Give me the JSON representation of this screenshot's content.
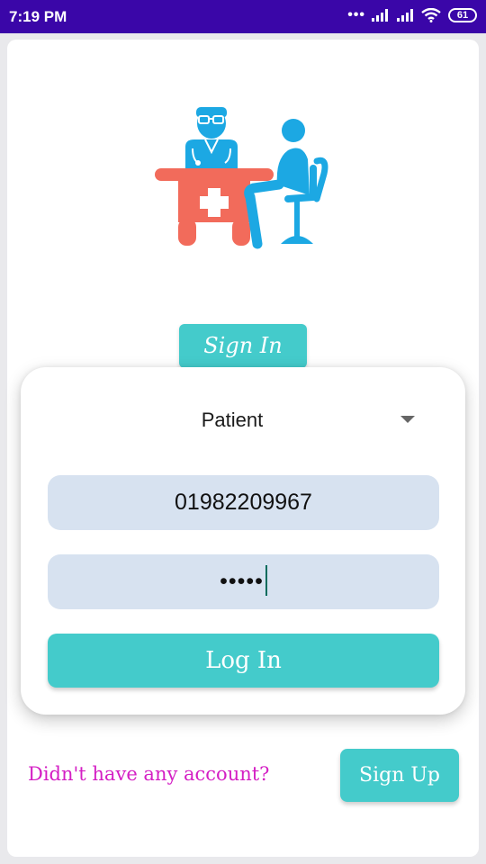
{
  "status_bar": {
    "time": "7:19 PM",
    "more_indicator": "•••",
    "battery_level": "61",
    "icons": [
      "signal-bars-icon",
      "signal-bars-icon",
      "wifi-icon",
      "battery-icon"
    ]
  },
  "hero": {
    "icon": "doctor-patient-consultation-icon",
    "colors": {
      "desk": "#f26b5b",
      "people": "#1ca8e3",
      "cross": "#ffffff"
    }
  },
  "sign_in_chip": {
    "label": "Sign In"
  },
  "login_form": {
    "role_selected": "Patient",
    "phone_value": "01982209967",
    "password_masked": "•••••",
    "login_label": "Log In"
  },
  "footer": {
    "account_prompt": "Didn't have any account?",
    "signup_label": "Sign Up"
  },
  "colors": {
    "accent": "#44cbcb",
    "status_bar": "#3a06a8",
    "field_bg": "#d7e2f0",
    "link": "#d41fc4"
  }
}
